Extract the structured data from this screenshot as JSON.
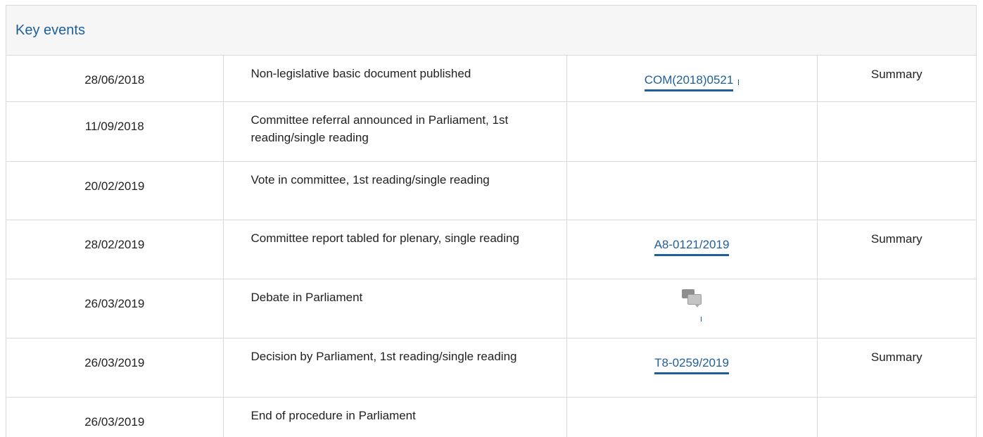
{
  "panel": {
    "title": "Key events"
  },
  "events": [
    {
      "date": "28/06/2018",
      "event": "Non-legislative basic document published",
      "document": "COM(2018)0521",
      "summary": "Summary"
    },
    {
      "date": "11/09/2018",
      "event": "Committee referral announced in Parliament, 1st reading/single reading",
      "document": "",
      "summary": ""
    },
    {
      "date": "20/02/2019",
      "event": "Vote in committee, 1st reading/single reading",
      "document": "",
      "summary": ""
    },
    {
      "date": "28/02/2019",
      "event": "Committee report tabled for plenary, single reading",
      "document": "A8-0121/2019",
      "summary": "Summary"
    },
    {
      "date": "26/03/2019",
      "event": "Debate in Parliament",
      "document": "debate-icon",
      "summary": ""
    },
    {
      "date": "26/03/2019",
      "event": "Decision by Parliament, 1st reading/single reading",
      "document": "T8-0259/2019",
      "summary": "Summary"
    },
    {
      "date": "26/03/2019",
      "event": "End of procedure in Parliament",
      "document": "",
      "summary": ""
    }
  ],
  "colors": {
    "link": "#1f5f99",
    "header_bg": "#f6f6f6",
    "border": "#d9d9d9"
  }
}
